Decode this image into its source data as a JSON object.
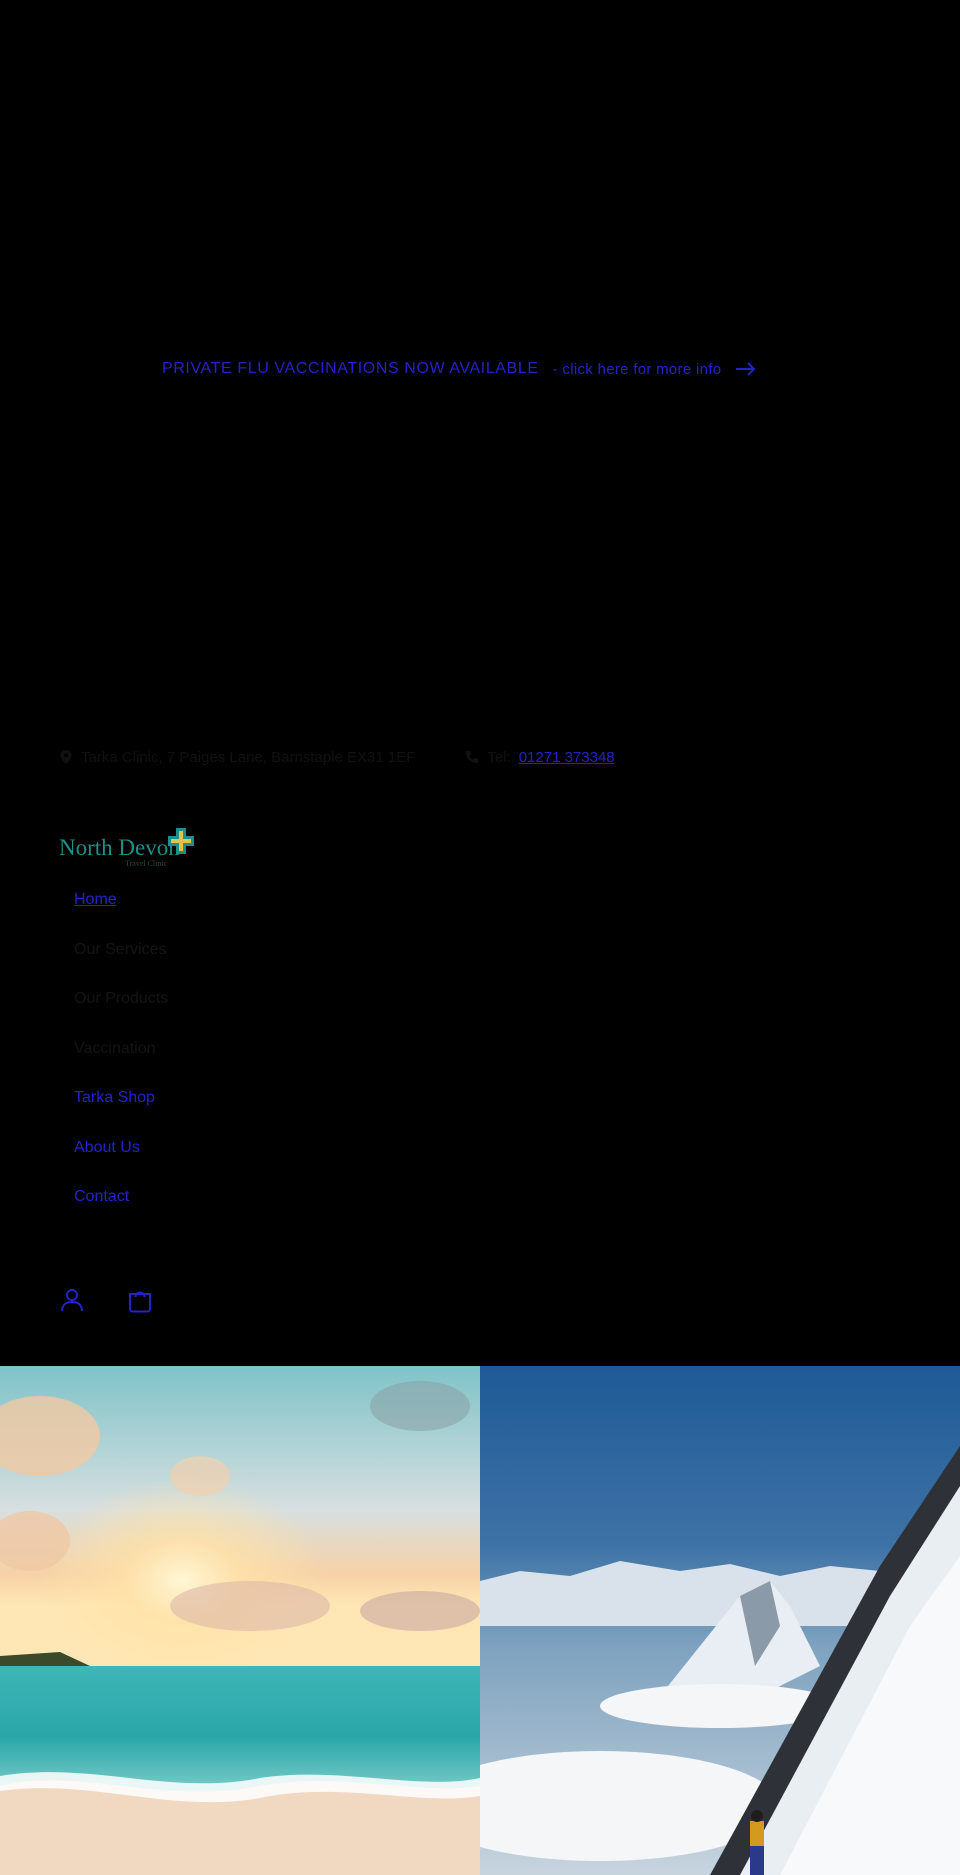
{
  "announcement": {
    "lead": "PRIVATE FLU VACCINATIONS NOW AVAILABLE",
    "rest": " - click here for more info",
    "icon": "arrow-right-icon"
  },
  "infobar": {
    "address": "Tarka Clinic, 7 Paiges Lane, Barnstaple EX31 1EF",
    "phone_label": "Tel: ",
    "phone_number": "01271 373348"
  },
  "logo": {
    "text_main": "North Devon",
    "text_sub": "Travel Clinic"
  },
  "nav": {
    "items": [
      {
        "label": "Home"
      },
      {
        "label": "Our Services"
      },
      {
        "label": "Our Products"
      },
      {
        "label": "Vaccination"
      },
      {
        "label": "Tarka Shop"
      },
      {
        "label": "About Us"
      },
      {
        "label": "Contact"
      }
    ]
  },
  "header_icons": {
    "account": "account-icon",
    "cart": "cart-icon"
  },
  "colors": {
    "background": "#000000",
    "link": "#2323c8",
    "muted_text": "#141414",
    "logo_teal": "#1e8f86"
  }
}
